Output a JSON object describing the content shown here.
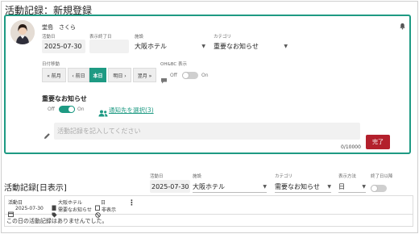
{
  "page": {
    "title": "活動記録：新規登録"
  },
  "form": {
    "user_name": "堂島　さくら",
    "activity_date_label": "活動日",
    "activity_date_value": "2025-07-30",
    "end_date_label": "表示終了日",
    "end_date_value": "",
    "facility_label": "施設",
    "facility_value": "大阪ホテル",
    "category_label": "カテゴリ",
    "category_value": "重要なお知らせ",
    "date_move_label": "日付移動",
    "nav_prev_month": "« 前月",
    "nav_prev_day": "‹ 前日",
    "nav_today": "本日",
    "nav_next_day": "明日 ›",
    "nav_next_month": "翌月 »",
    "ohbc_label": "OH&BC 表示",
    "ohbc_off": "Off",
    "ohbc_on": "On",
    "important_title": "重要なお知らせ",
    "important_off": "Off",
    "important_on": "On",
    "notify_link": "通知先を選択(3)",
    "memo_placeholder": "活動記録を記入してください",
    "char_count": "0/10000",
    "complete_button": "完了"
  },
  "daily": {
    "title": "活動記録[日表示]",
    "date_label": "活動日",
    "date_value": "2025-07-30",
    "facility_label": "施設",
    "facility_value": "大阪ホテル",
    "category_label": "カテゴリ",
    "category_value": "需要なお知らせ",
    "display_label": "表示方法",
    "display_value": "日",
    "ended_label": "終了日以降",
    "info_activity_label": "活動日",
    "info_activity_value": "2025-07-30",
    "info_facility_value": "大阪ホテル",
    "info_category_value": "需要なお知らせ",
    "info_day_label": "日",
    "info_hidden_label": "非表示",
    "more_label": "⋮",
    "empty_message": "この日の活動記録はありませんでした。"
  },
  "colors": {
    "accent": "#1e9a83",
    "complete_button": "#b3202c"
  },
  "icons": [
    "bell-icon",
    "avatar",
    "chat-icon",
    "users-icon",
    "pencil-icon",
    "calendar-icon",
    "building-icon",
    "tag-icon",
    "eye-slash-icon",
    "more-icon"
  ]
}
